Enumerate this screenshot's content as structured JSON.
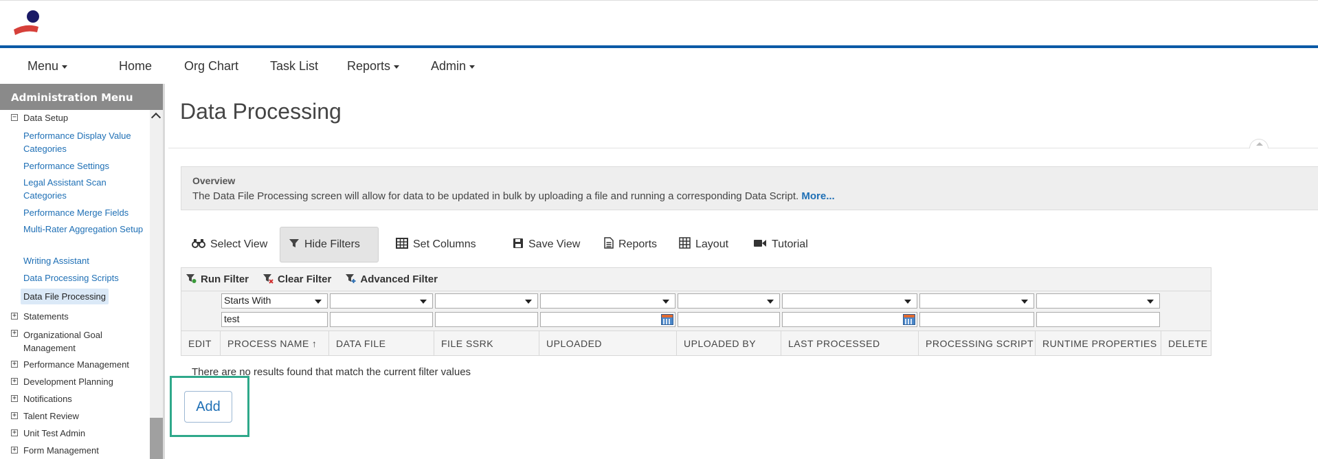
{
  "nav": {
    "menu": "Menu",
    "home": "Home",
    "org_chart": "Org Chart",
    "task_list": "Task List",
    "reports": "Reports",
    "admin": "Admin"
  },
  "sidebar": {
    "header": "Administration Menu",
    "root": "Data Setup",
    "items": [
      "Performance Display Value Categories",
      "Performance Settings",
      "Legal Assistant Scan Categories",
      "Performance Merge Fields",
      "Multi-Rater Aggregation Setup",
      "Writing Assistant",
      "Data Processing Scripts",
      "Data File Processing"
    ],
    "sections": [
      "Statements",
      "Organizational Goal Management",
      "Performance Management",
      "Development Planning",
      "Notifications",
      "Talent Review",
      "Unit Test Admin",
      "Form Management"
    ]
  },
  "page": {
    "title": "Data Processing"
  },
  "overview": {
    "title": "Overview",
    "text": "The Data File Processing screen will allow for data to be updated in bulk by uploading a file and running a corresponding Data Script.",
    "more": "More..."
  },
  "toolbar": {
    "select_view": "Select View",
    "hide_filters": "Hide Filters",
    "set_columns": "Set Columns",
    "save_view": "Save View",
    "reports": "Reports",
    "layout": "Layout",
    "tutorial": "Tutorial"
  },
  "filter_bar": {
    "run_filter": "Run Filter",
    "clear_filter": "Clear Filter",
    "advanced_filter": "Advanced Filter"
  },
  "filters": {
    "process_name_operator": "Starts With",
    "process_name_value": "test"
  },
  "columns": [
    "EDIT",
    "PROCESS NAME",
    "DATA FILE",
    "FILE SSRK",
    "UPLOADED",
    "UPLOADED BY",
    "LAST PROCESSED",
    "PROCESSING SCRIPT",
    "RUNTIME PROPERTIES",
    "DELETE"
  ],
  "empty_message": "There are no results found that match the current filter values",
  "add_button": "Add",
  "colors": {
    "brand_blue": "#0b5aa6",
    "link_blue": "#1e6fb5",
    "highlight_green": "#2ea88a",
    "sidebar_header": "#8a8a8a"
  }
}
